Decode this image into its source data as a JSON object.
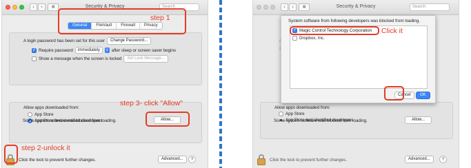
{
  "left_window": {
    "title": "Security & Privacy",
    "search_placeholder": "Search",
    "tabs": [
      {
        "label": "General",
        "active": true
      },
      {
        "label": "FileVault",
        "active": false
      },
      {
        "label": "Firewall",
        "active": false
      },
      {
        "label": "Privacy",
        "active": false
      }
    ],
    "login_password_text": "A login password has been set for this user",
    "change_password_button": "Change Password...",
    "require_password_label": "Require password",
    "require_password_checked": true,
    "require_password_value": "immediately",
    "after_sleep_text": "after sleep or screen saver begins",
    "show_message_label": "Show a message when the screen is locked",
    "show_message_checked": false,
    "set_lock_message_button": "Set Lock Message...",
    "allow_apps_heading": "Allow apps downloaded from:",
    "radio_app_store": "App Store",
    "radio_identified": "App Store and identified developers",
    "blocked_text": "Some system software was blocked from loading.",
    "allow_button": "Allow...",
    "lock_text": "Click the lock to prevent further changes.",
    "advanced_button": "Advanced...",
    "help_button": "?"
  },
  "annotations": {
    "step1": "step 1",
    "step2": "step 2-unlock it",
    "step3": "step 3- click \"Allow\"",
    "click_it": "Click it"
  },
  "right_window": {
    "title": "Security & Privacy",
    "search_placeholder": "Search",
    "sheet_message": "System software from following developers was blocked from loading.",
    "developers": [
      {
        "name": "Magic Control Technology Corporation",
        "checked": true
      },
      {
        "name": "Dropbox, Inc.",
        "checked": false
      }
    ],
    "cancel_button": "Cancel",
    "ok_button": "OK",
    "allow_apps_heading": "Allow apps downloaded from:",
    "radio_app_store": "App Store",
    "radio_identified": "App Store and identified developers",
    "blocked_text": "Some system software was blocked from loading.",
    "allow_button": "Allow...",
    "lock_text": "Click the lock to prevent further changes.",
    "advanced_button": "Advanced...",
    "help_button": "?"
  },
  "colors": {
    "accent": "#3b86f6",
    "annotation_red": "#e33b27",
    "divider_blue": "#2e75c8"
  }
}
